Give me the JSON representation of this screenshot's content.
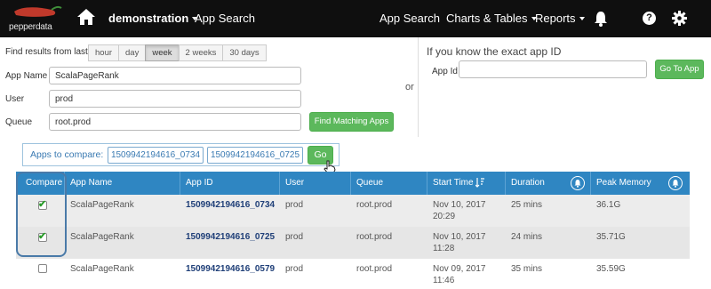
{
  "nav": {
    "logo_text": "pepperdata",
    "project": "demonstration",
    "page_title": "App Search",
    "links": [
      "App Search",
      "Charts & Tables",
      "Reports"
    ],
    "help_glyph": "?"
  },
  "search": {
    "filter_label": "Find results from last:",
    "ranges": [
      "hour",
      "day",
      "week",
      "2 weeks",
      "30 days"
    ],
    "active_range": "week",
    "app_name_label": "App Name",
    "app_name_value": "ScalaPageRank",
    "user_label": "User",
    "user_value": "prod",
    "queue_label": "Queue",
    "queue_value": "root.prod",
    "find_button": "Find Matching Apps",
    "or_text": "or",
    "exact_title": "If you know the exact app ID",
    "app_id_label": "App Id",
    "app_id_value": "",
    "go_to_app_button": "Go To App"
  },
  "compare": {
    "label": "Apps to compare:",
    "ids": [
      "1509942194616_0734",
      "1509942194616_0725"
    ],
    "go_button": "Go"
  },
  "table": {
    "columns": [
      "Compare",
      "App Name",
      "App ID",
      "User",
      "Queue",
      "Start Time",
      "Duration",
      "Peak Memory"
    ],
    "rows": [
      {
        "checked": true,
        "app_name": "ScalaPageRank",
        "app_id": "1509942194616_0734",
        "user": "prod",
        "queue": "root.prod",
        "start_date": "Nov 10, 2017",
        "start_time": "20:29",
        "duration": "25 mins",
        "peak_memory": "36.1G"
      },
      {
        "checked": true,
        "app_name": "ScalaPageRank",
        "app_id": "1509942194616_0725",
        "user": "prod",
        "queue": "root.prod",
        "start_date": "Nov 10, 2017",
        "start_time": "11:28",
        "duration": "24 mins",
        "peak_memory": "35.71G"
      },
      {
        "checked": false,
        "app_name": "ScalaPageRank",
        "app_id": "1509942194616_0579",
        "user": "prod",
        "queue": "root.prod",
        "start_date": "Nov 09, 2017",
        "start_time": "11:46",
        "duration": "35 mins",
        "peak_memory": "35.59G"
      }
    ]
  },
  "colors": {
    "navbar": "#0f0f0f",
    "table_header": "#2f86c2",
    "green_button": "#5cb85c",
    "link": "#1f3f78",
    "logo_pepper": "#c0392b"
  },
  "icons": [
    "pepper-logo-icon",
    "home-icon",
    "bell-icon",
    "help-icon",
    "gear-icon",
    "sort-icon",
    "bell-circle-icon",
    "checkbox-icon",
    "hand-cursor-icon"
  ]
}
